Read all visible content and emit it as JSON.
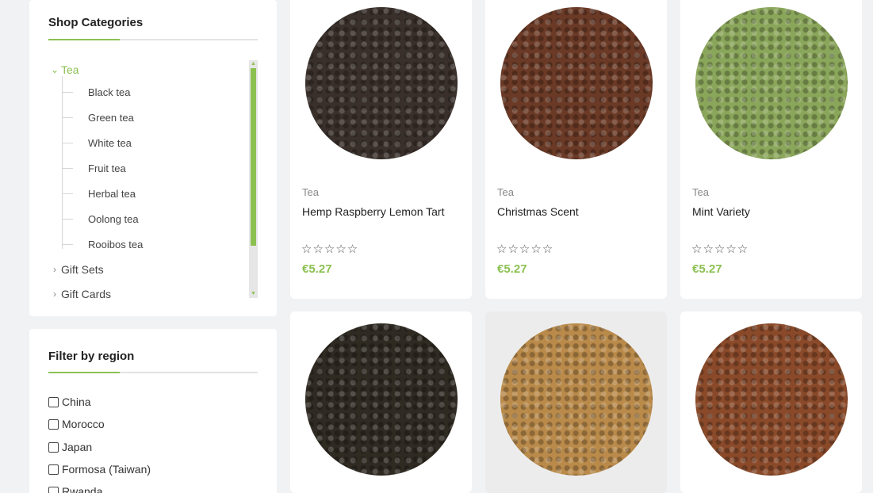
{
  "categories_panel": {
    "title": "Shop Categories",
    "root_active": {
      "label": "Tea",
      "chevron": "chevron-down-icon"
    },
    "children": [
      "Black tea",
      "Green tea",
      "White tea",
      "Fruit tea",
      "Herbal tea",
      "Oolong tea",
      "Rooibos tea"
    ],
    "other_roots": [
      {
        "label": "Gift Sets",
        "chevron": "chevron-right-icon"
      },
      {
        "label": "Gift Cards",
        "chevron": "chevron-right-icon"
      }
    ]
  },
  "region_panel": {
    "title": "Filter by region",
    "options": [
      {
        "label": "China",
        "checked": false
      },
      {
        "label": "Morocco",
        "checked": false
      },
      {
        "label": "Japan",
        "checked": false
      },
      {
        "label": "Formosa (Taiwan)",
        "checked": false
      },
      {
        "label": "Rwanda",
        "checked": false
      }
    ]
  },
  "products": [
    {
      "category": "Tea",
      "name": "Hemp Raspberry Lemon Tart",
      "rating": "☆☆☆☆☆",
      "price": "€5.27",
      "tea_color": "#3a302b"
    },
    {
      "category": "Tea",
      "name": "Christmas Scent",
      "rating": "☆☆☆☆☆",
      "price": "€5.27",
      "tea_color": "#6b3a26"
    },
    {
      "category": "Tea",
      "name": "Mint Variety",
      "rating": "☆☆☆☆☆",
      "price": "€5.27",
      "tea_color": "#8aa65a"
    },
    {
      "category": "",
      "name": "",
      "rating": "",
      "price": "",
      "tea_color": "#2f2a22"
    },
    {
      "category": "",
      "name": "",
      "rating": "",
      "price": "",
      "tea_color": "#b98a4a"
    },
    {
      "category": "",
      "name": "",
      "rating": "",
      "price": "",
      "tea_color": "#8a4a2a"
    }
  ],
  "colors": {
    "accent": "#8cc152",
    "page_background": "#f1f2f4"
  }
}
